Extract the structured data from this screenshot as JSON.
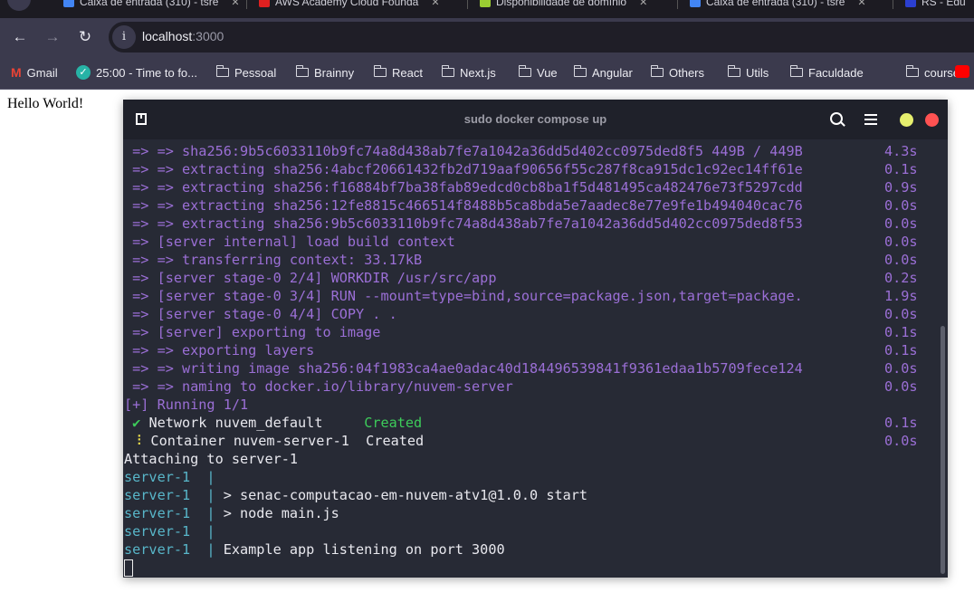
{
  "browser": {
    "tabs": [
      {
        "title": "Caixa de entrada (310) - tsre",
        "color": "#4285f4"
      },
      {
        "title": "AWS Academy Cloud Founda",
        "color": "#e02020"
      },
      {
        "title": "Disponibilidade de domínio",
        "color": "#9acd32"
      },
      {
        "title": "Caixa de entrada (310) - tsre",
        "color": "#4285f4"
      },
      {
        "title": "RS - Edu",
        "color": "#2b3fd0"
      }
    ],
    "url_host": "localhost",
    "url_port": ":3000",
    "bookmarks": [
      "Gmail",
      "25:00 - Time to fo...",
      "Pessoal",
      "Brainny",
      "React",
      "Next.js",
      "Vue",
      "Angular",
      "Others",
      "Utils",
      "Faculdade",
      "course"
    ]
  },
  "page": {
    "text": "Hello World!"
  },
  "terminal": {
    "title": "sudo docker compose up",
    "lines": [
      {
        "segs": [
          {
            "t": " => => ",
            "c": "p"
          },
          {
            "t": "sha256:9b5c6033110b9fc74a8d438ab7fe7a1042a36dd5d402cc0975ded8f5 449B / 449B",
            "c": "p"
          }
        ],
        "time": "4.3s"
      },
      {
        "segs": [
          {
            "t": " => => extracting sha256:4abcf20661432fb2d719aaf90656f55c287f8ca915dc1c92ec14ff61e",
            "c": "p"
          }
        ],
        "time": "0.1s"
      },
      {
        "segs": [
          {
            "t": " => => extracting sha256:f16884bf7ba38fab89edcd0cb8ba1f5d481495ca482476e73f5297cdd",
            "c": "p"
          }
        ],
        "time": "0.9s"
      },
      {
        "segs": [
          {
            "t": " => => extracting sha256:12fe8815c466514f8488b5ca8bda5e7aadec8e77e9fe1b494040cac76",
            "c": "p"
          }
        ],
        "time": "0.0s"
      },
      {
        "segs": [
          {
            "t": " => => extracting sha256:9b5c6033110b9fc74a8d438ab7fe7a1042a36dd5d402cc0975ded8f53",
            "c": "p"
          }
        ],
        "time": "0.0s"
      },
      {
        "segs": [
          {
            "t": " => [server internal] load build context",
            "c": "p"
          }
        ],
        "time": "0.0s"
      },
      {
        "segs": [
          {
            "t": " => => transferring context: 33.17kB",
            "c": "p"
          }
        ],
        "time": "0.0s"
      },
      {
        "segs": [
          {
            "t": " => [server stage-0 2/4] WORKDIR /usr/src/app",
            "c": "p"
          }
        ],
        "time": "0.2s"
      },
      {
        "segs": [
          {
            "t": " => [server stage-0 3/4] RUN --mount=type=bind,source=package.json,target=package.",
            "c": "p"
          }
        ],
        "time": "1.9s"
      },
      {
        "segs": [
          {
            "t": " => [server stage-0 4/4] COPY . .",
            "c": "p"
          }
        ],
        "time": "0.0s"
      },
      {
        "segs": [
          {
            "t": " => [server] exporting to image",
            "c": "p"
          }
        ],
        "time": "0.1s"
      },
      {
        "segs": [
          {
            "t": " => => exporting layers",
            "c": "p"
          }
        ],
        "time": "0.1s"
      },
      {
        "segs": [
          {
            "t": " => => writing image sha256:04f1983ca4ae0adac40d184496539841f9361edaa1b5709fece124",
            "c": "p"
          }
        ],
        "time": "0.0s"
      },
      {
        "segs": [
          {
            "t": " => => naming to docker.io/library/nuvem-server",
            "c": "p"
          }
        ],
        "time": "0.0s"
      },
      {
        "segs": [
          {
            "t": "[+] Running 1/1",
            "c": "p"
          }
        ]
      },
      {
        "segs": [
          {
            "t": " ✔",
            "c": "g"
          },
          {
            "t": " Network nuvem_default     ",
            "c": "w"
          },
          {
            "t": "Created",
            "c": "g"
          }
        ],
        "time": "0.1s"
      },
      {
        "segs": [
          {
            "t": " ⠸",
            "c": "y"
          },
          {
            "t": " Container nuvem-server-1  Created",
            "c": "w"
          }
        ],
        "time": "0.0s"
      },
      {
        "segs": [
          {
            "t": "Attaching to server-1",
            "c": "w"
          }
        ]
      },
      {
        "segs": [
          {
            "t": "server-1  |",
            "c": "c"
          }
        ]
      },
      {
        "segs": [
          {
            "t": "server-1  | ",
            "c": "c"
          },
          {
            "t": "> senac-computacao-em-nuvem-atv1@1.0.0 start",
            "c": "w"
          }
        ]
      },
      {
        "segs": [
          {
            "t": "server-1  | ",
            "c": "c"
          },
          {
            "t": "> node main.js",
            "c": "w"
          }
        ]
      },
      {
        "segs": [
          {
            "t": "server-1  |",
            "c": "c"
          }
        ]
      },
      {
        "segs": [
          {
            "t": "server-1  | ",
            "c": "c"
          },
          {
            "t": "Example app listening on port 3000",
            "c": "w"
          }
        ]
      }
    ]
  },
  "colors": {
    "minimize": "#e6ef6e",
    "close": "#ff5252",
    "accent_purple": "#9b6fd6",
    "accent_cyan": "#58b6c9",
    "accent_green": "#3dcc5a"
  }
}
